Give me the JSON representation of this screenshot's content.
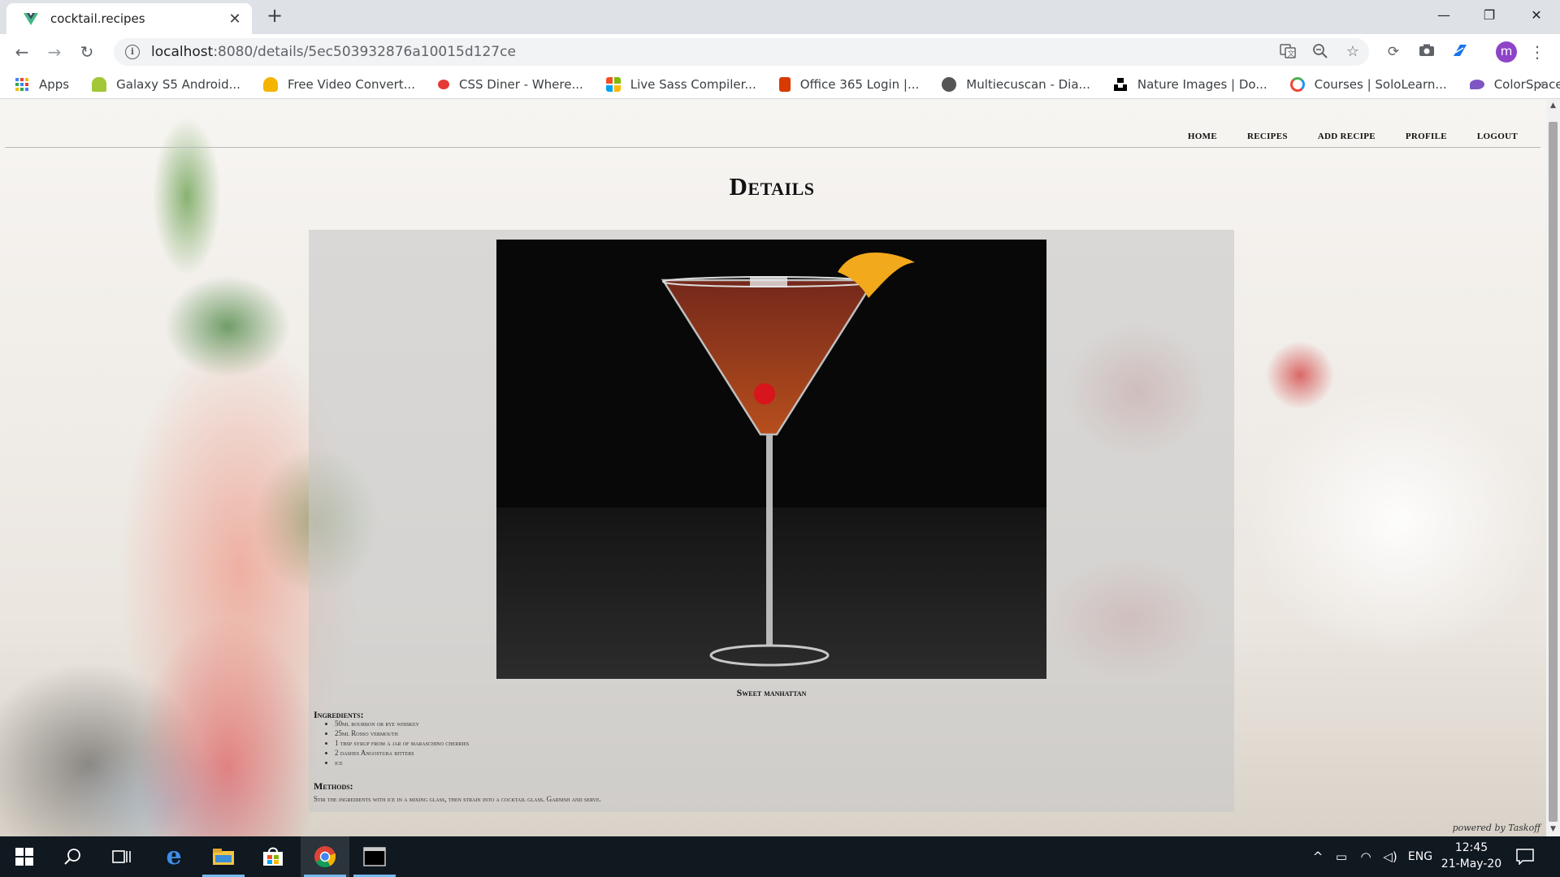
{
  "browser": {
    "tab_title": "cocktail.recipes",
    "tab_close": "✕",
    "new_tab": "+",
    "url_host": "localhost",
    "url_rest": ":8080/details/5ec503932876a10015d127ce",
    "avatar_letter": "m",
    "window_controls": {
      "minimize": "—",
      "restore": "❐",
      "close": "✕"
    }
  },
  "bookmarks": [
    {
      "label": "Apps",
      "icon": "apps-grid-icon",
      "color": "#4285f4"
    },
    {
      "label": "Galaxy S5 Android...",
      "icon": "android-icon",
      "color": "#a4c639"
    },
    {
      "label": "Free Video Convert...",
      "icon": "video-converter-icon",
      "color": "#f4b400"
    },
    {
      "label": "CSS Diner - Where...",
      "icon": "css-diner-icon",
      "color": "#e53935"
    },
    {
      "label": "Live Sass Compiler...",
      "icon": "microsoft-icon",
      "color": "#0078d4"
    },
    {
      "label": "Office 365 Login |...",
      "icon": "office-icon",
      "color": "#d83b01"
    },
    {
      "label": "Multiecuscan - Dia...",
      "icon": "globe-icon",
      "color": "#555555"
    },
    {
      "label": "Nature Images | Do...",
      "icon": "unsplash-icon",
      "color": "#000000"
    },
    {
      "label": "Courses | SoloLearn...",
      "icon": "sololearn-icon",
      "color": "#f44336"
    },
    {
      "label": "ColorSpace - CSS G...",
      "icon": "colorspace-icon",
      "color": "#7e57c2"
    }
  ],
  "site": {
    "nav": [
      "HOME",
      "RECIPES",
      "ADD RECIPE",
      "PROFILE",
      "LOGOUT"
    ],
    "page_title": "Details",
    "recipe_name": "Sweet manhattan",
    "ingredients_heading": "Ingredients:",
    "ingredients": [
      "50ml bourbon or rye whiskey",
      "25ml Rosso vermouth",
      "1 tbsp syrup from a jar of maraschino cherries",
      "2 dashes Angostura bitters",
      "ice"
    ],
    "methods_heading": "Methods:",
    "methods": "Stir the ingredients with ice in a mixing glass, then strain into a cocktail glass. Garnish and serve.",
    "powered_by": "powered by Taskoff"
  },
  "taskbar": {
    "time": "12:45",
    "date": "21-May-20",
    "language": "ENG"
  },
  "colors": {
    "accent": "#76b9ed",
    "taskbar": "#101820",
    "card": "rgba(200,200,200,0.62)"
  }
}
